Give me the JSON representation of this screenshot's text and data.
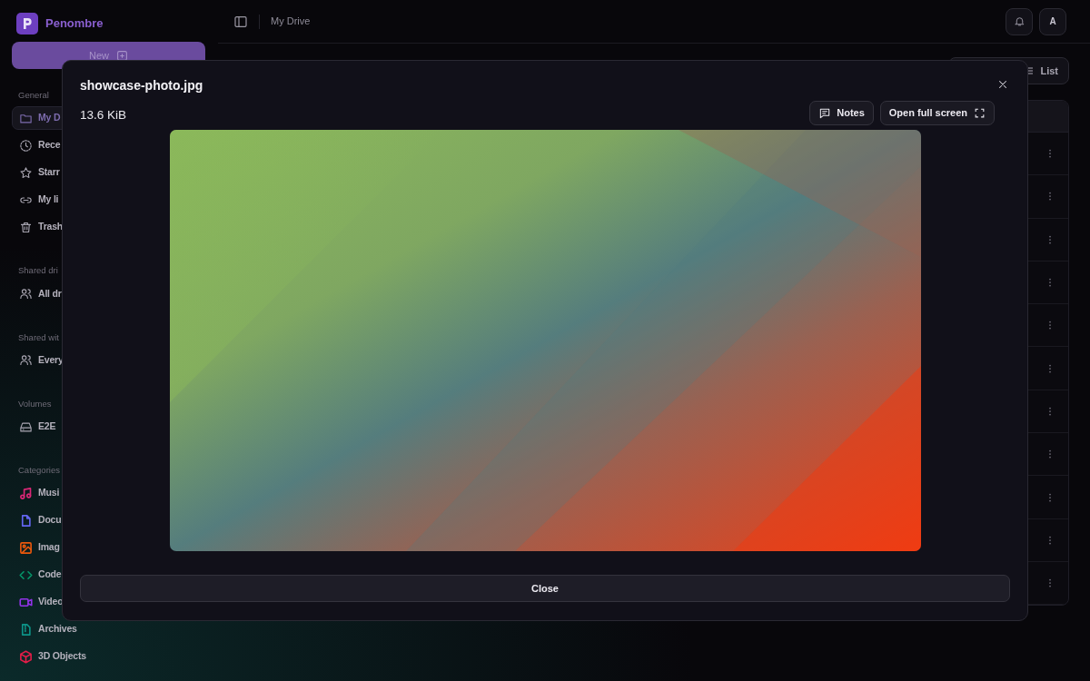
{
  "app": {
    "name": "Penombre"
  },
  "new_button": {
    "label": "New"
  },
  "sidebar": {
    "sections": [
      {
        "title": "General",
        "items": [
          {
            "label": "My D",
            "selected": true
          },
          {
            "label": "Rece",
            "selected": false
          },
          {
            "label": "Starr",
            "selected": false
          },
          {
            "label": "My li",
            "selected": false
          },
          {
            "label": "Trash",
            "selected": false
          }
        ]
      },
      {
        "title": "Shared dri",
        "items": [
          {
            "label": "All dr",
            "selected": false
          }
        ]
      },
      {
        "title": "Shared wit",
        "items": [
          {
            "label": "Every",
            "selected": false
          }
        ]
      },
      {
        "title": "Volumes",
        "items": [
          {
            "label": "E2E",
            "selected": false
          }
        ]
      },
      {
        "title": "Categories",
        "items": [
          {
            "label": "Musi",
            "selected": false,
            "color": "#db2777"
          },
          {
            "label": "Docu",
            "selected": false,
            "color": "#6366f1"
          },
          {
            "label": "Imag",
            "selected": false,
            "color": "#ea580c"
          },
          {
            "label": "Code",
            "selected": false,
            "color": "#059669"
          },
          {
            "label": "Video",
            "selected": false,
            "color": "#9333ea"
          },
          {
            "label": "Archives",
            "selected": false,
            "color": "#0d9488"
          },
          {
            "label": "3D Objects",
            "selected": false,
            "color": "#e11d48"
          }
        ]
      }
    ]
  },
  "topbar": {
    "breadcrumb": "My Drive",
    "avatar": "A"
  },
  "view_button": {
    "label": "List"
  },
  "modal": {
    "title": "showcase-photo.jpg",
    "size": "13.6 KiB",
    "notes_button": "Notes",
    "fullscreen_button": "Open full screen",
    "close_button": "Close"
  }
}
